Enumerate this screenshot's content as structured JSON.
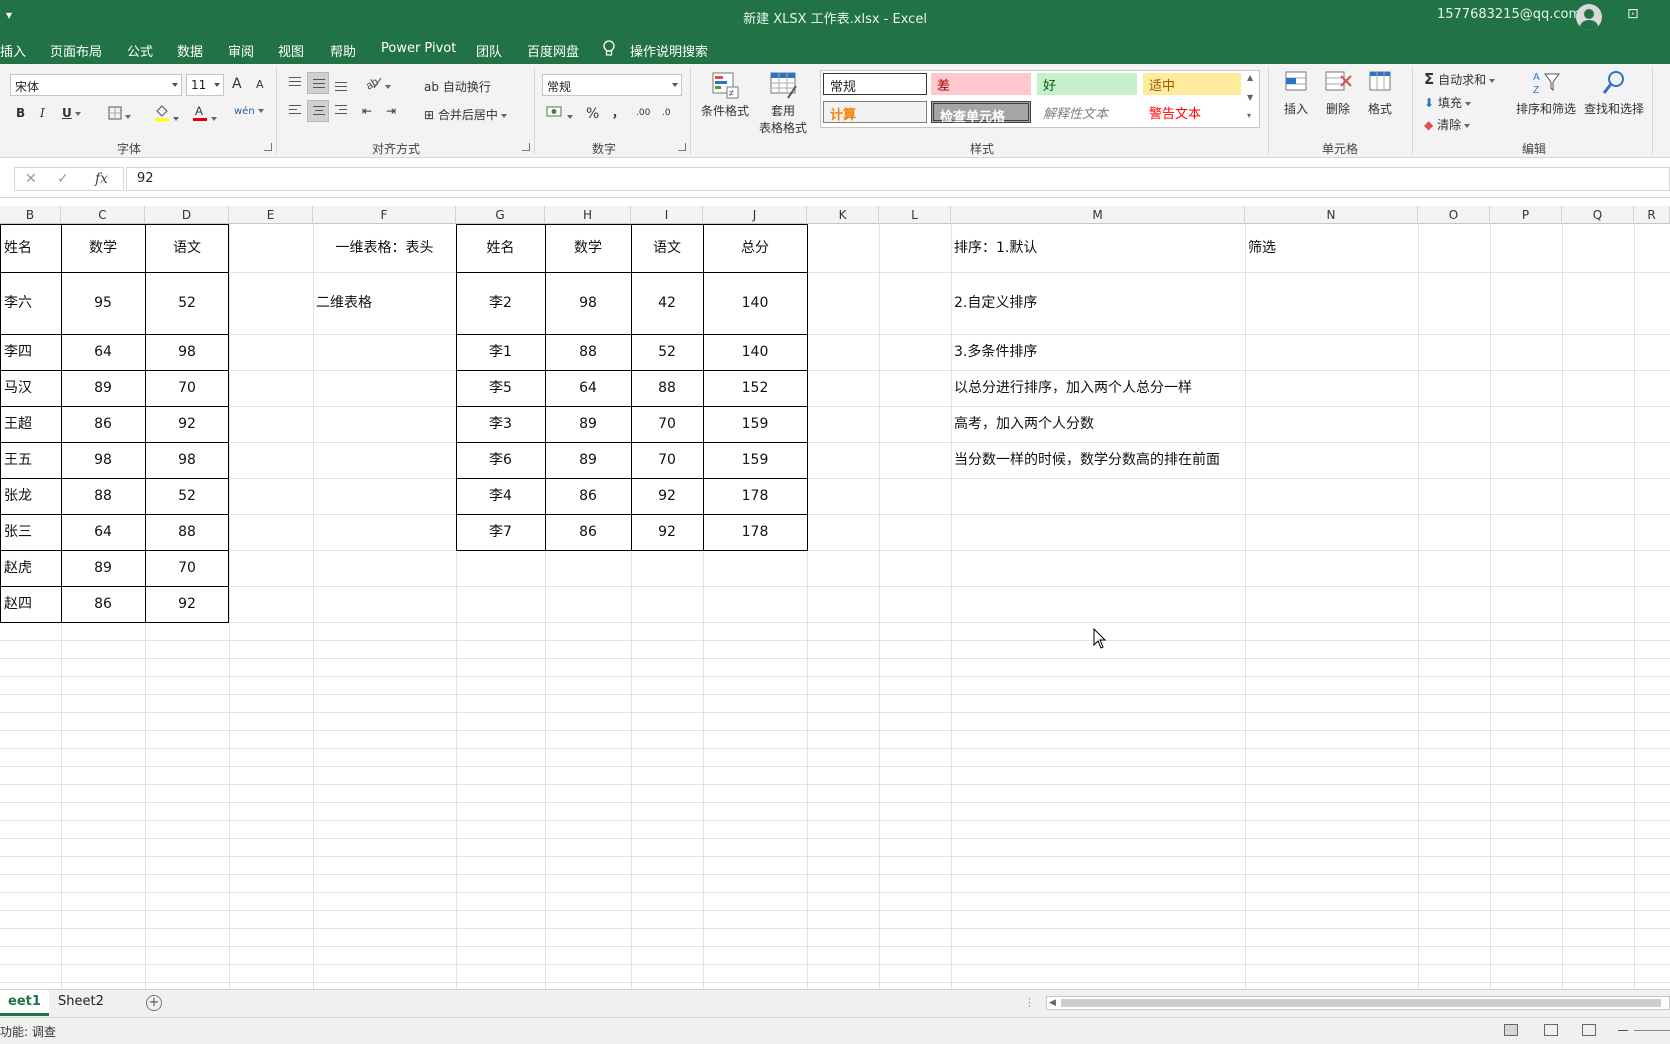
{
  "window": {
    "title": "新建 XLSX 工作表.xlsx  -  Excel",
    "account": "1577683215@qq.com",
    "quick_access": "▾"
  },
  "menu": {
    "tabs": [
      "插入",
      "页面布局",
      "公式",
      "数据",
      "审阅",
      "视图",
      "帮助",
      "Power Pivot",
      "团队",
      "百度网盘",
      "操作说明搜索"
    ]
  },
  "ribbon": {
    "font": {
      "name": "宋体",
      "size": "11",
      "group_label": "字体",
      "increase": "A",
      "decrease": "A",
      "bold": "B",
      "italic": "I",
      "underline": "U",
      "wen": "wén"
    },
    "alignment": {
      "wrap": "自动换行",
      "merge": "合并后居中",
      "group_label": "对齐方式"
    },
    "number": {
      "format": "常规",
      "percent": "%",
      "comma": "，",
      "inc": ".00",
      "dec": ".0",
      "group_label": "数字"
    },
    "styles": {
      "conditional": "条件格式",
      "table_format_line1": "套用",
      "table_format_line2": "表格格式",
      "group_label": "样式",
      "cells": [
        {
          "label": "常规",
          "bg": "#ffffff",
          "color": "#000000"
        },
        {
          "label": "差",
          "bg": "#ffc7ce",
          "color": "#9c0006"
        },
        {
          "label": "好",
          "bg": "#c6efce",
          "color": "#006100"
        },
        {
          "label": "适中",
          "bg": "#ffeb9c",
          "color": "#9c5700"
        },
        {
          "label": "计算",
          "bg": "#f2f2f2",
          "color": "#fa7d00"
        },
        {
          "label": "检查单元格",
          "bg": "#a5a5a5",
          "color": "#ffffff"
        },
        {
          "label": "解释性文本",
          "bg": "#ffffff",
          "color": "#7f7f7f"
        },
        {
          "label": "警告文本",
          "bg": "#ffffff",
          "color": "#ff0000"
        }
      ]
    },
    "cells_group": {
      "insert": "插入",
      "delete": "删除",
      "format": "格式",
      "group_label": "单元格"
    },
    "editing": {
      "autosum": "自动求和",
      "fill": "填充",
      "clear": "清除",
      "sort_filter": "排序和筛选",
      "find_select": "查找和选择",
      "group_label": "编辑"
    }
  },
  "formula_bar": {
    "cancel": "✕",
    "enter": "✓",
    "fx": "fx",
    "value": "92"
  },
  "columns": [
    "B",
    "C",
    "D",
    "E",
    "F",
    "G",
    "H",
    "I",
    "J",
    "K",
    "L",
    "M",
    "N",
    "O",
    "P",
    "Q",
    "R"
  ],
  "table1": {
    "headers": [
      "姓名",
      "数学",
      "语文"
    ],
    "rows": [
      [
        "李六",
        "95",
        "52"
      ],
      [
        "李四",
        "64",
        "98"
      ],
      [
        "马汉",
        "89",
        "70"
      ],
      [
        "王超",
        "86",
        "92"
      ],
      [
        "王五",
        "98",
        "98"
      ],
      [
        "张龙",
        "88",
        "52"
      ],
      [
        "张三",
        "64",
        "88"
      ],
      [
        "赵虎",
        "89",
        "70"
      ],
      [
        "赵四",
        "86",
        "92"
      ]
    ]
  },
  "notes_f": [
    "一维表格：表头",
    "二维表格"
  ],
  "table2": {
    "headers": [
      "姓名",
      "数学",
      "语文",
      "总分"
    ],
    "rows": [
      [
        "李2",
        "98",
        "42",
        "140"
      ],
      [
        "李1",
        "88",
        "52",
        "140"
      ],
      [
        "李5",
        "64",
        "88",
        "152"
      ],
      [
        "李3",
        "89",
        "70",
        "159"
      ],
      [
        "李6",
        "89",
        "70",
        "159"
      ],
      [
        "李4",
        "86",
        "92",
        "178"
      ],
      [
        "李7",
        "86",
        "92",
        "178"
      ]
    ]
  },
  "notes_m": [
    "排序：1.默认",
    "2.自定义排序",
    "3.多条件排序",
    "以总分进行排序，加入两个人总分一样",
    "高考，加入两个人分数",
    "当分数一样的时候，数学分数高的排在前面"
  ],
  "notes_n": [
    "筛选"
  ],
  "sheets": {
    "tabs": [
      "eet1",
      "Sheet2"
    ],
    "add": "+"
  },
  "status": {
    "text": "功能: 调查"
  }
}
